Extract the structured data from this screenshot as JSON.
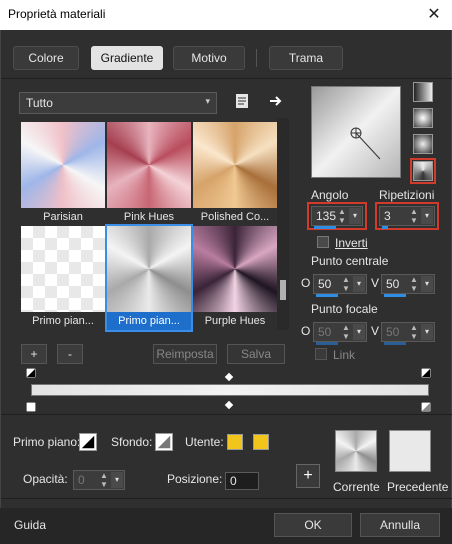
{
  "window": {
    "title": "Proprietà materiali",
    "close_glyph": "✕"
  },
  "tabs": [
    {
      "label": "Colore",
      "active": false
    },
    {
      "label": "Gradiente",
      "active": true
    },
    {
      "label": "Motivo",
      "active": false
    },
    {
      "label": "Trama",
      "active": false
    }
  ],
  "category": {
    "value": "Tutto",
    "arrow": "▾"
  },
  "gradients": [
    {
      "label": "Parisian"
    },
    {
      "label": "Pink Hues"
    },
    {
      "label": "Polished Co..."
    },
    {
      "label": "Primo pian..."
    },
    {
      "label": "Primo pian...",
      "selected": true
    },
    {
      "label": "Purple Hues"
    }
  ],
  "list_buttons": {
    "add": "+",
    "remove": "-",
    "reset": "Reimposta",
    "save": "Salva"
  },
  "angle": {
    "label": "Angolo",
    "value": "135"
  },
  "repeats": {
    "label": "Ripetizioni",
    "value": "3"
  },
  "invert": {
    "label": "Inverti"
  },
  "center": {
    "label": "Punto centrale",
    "x_label": "O",
    "x": "50",
    "y_label": "V",
    "y": "50"
  },
  "focal": {
    "label": "Punto focale",
    "x_label": "O",
    "x": "50",
    "y_label": "V",
    "y": "50"
  },
  "link": {
    "label": "Link"
  },
  "bottom": {
    "foreground_label": "Primo piano:",
    "background_label": "Sfondo:",
    "user_label": "Utente:",
    "opacity_label": "Opacità:",
    "opacity_value": "0",
    "position_label": "Posizione:",
    "position_value": "0",
    "current_label": "Corrente",
    "previous_label": "Precedente",
    "user_color": "#f2c51c"
  },
  "footer": {
    "help": "Guida",
    "ok": "OK",
    "cancel": "Annulla"
  }
}
